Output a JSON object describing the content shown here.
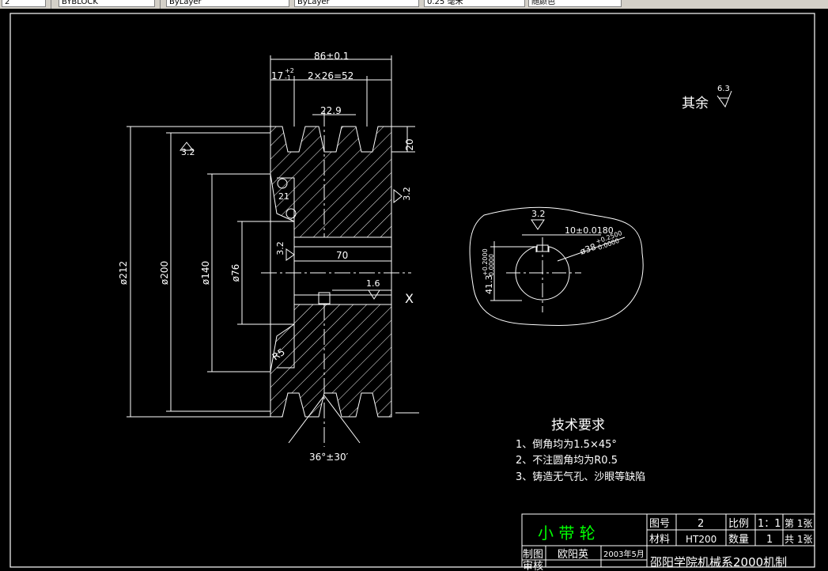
{
  "toolbar": {
    "fields": [
      {
        "value": "2"
      },
      {
        "value": "BYBLOCK"
      },
      {
        "value": "ByLayer"
      },
      {
        "value": "ByLayer"
      },
      {
        "value": "0.25 毫米"
      },
      {
        "value": "随颜色"
      }
    ]
  },
  "colors": {
    "background": "#000000",
    "lines": "#ffffff",
    "title_text": "#00ff00",
    "hatch": "#ffffff"
  },
  "drawing": {
    "dims": {
      "overall_width": "86±0.1",
      "first_groove": "17",
      "first_groove_tol_up": "+2",
      "first_groove_tol_dn": "-1",
      "groove_pitch": "2×26=52",
      "groove_top": "22.9",
      "groove_depth": "20",
      "rough_left": "3.2",
      "rough_right": "3.2",
      "rough_bore": "3.2",
      "chamfer": "21",
      "hub_length": "70",
      "rough_key": "1.6",
      "dia_212": "ø212",
      "dia_200": "ø200",
      "dia_140": "ø140",
      "dia_76": "ø76",
      "fillet": "R5",
      "groove_angle": "36°±30′",
      "section_mark": "X"
    },
    "section": {
      "rough": "3.2",
      "key_width": "10±0.0180",
      "bore_dia": "ø38",
      "bore_tol_up": "+0.2500",
      "bore_tol_dn": "0.0000",
      "key_depth": "41.3",
      "key_depth_tol_up": "+0.2000",
      "key_depth_tol_dn": "0.0000"
    },
    "rough_rest": {
      "label": "其余",
      "value": "6.3"
    },
    "tech": {
      "title": "技术要求",
      "items": [
        "1、倒角均为1.5×45°",
        "2、不注圆角均为R0.5",
        "3、铸造无气孔、沙眼等缺陷"
      ]
    }
  },
  "title_block": {
    "part_name": "小 带 轮",
    "drawing_no_label": "图号",
    "drawing_no": "2",
    "scale_label": "比例",
    "scale": "1：1",
    "sheet": "第 1张",
    "material_label": "材料",
    "material": "HT200",
    "qty_label": "数量",
    "qty": "1",
    "total_sheets": "共 1张",
    "drawn_label": "制图",
    "drawn_by": "欧阳英",
    "date": "2003年5月",
    "checked_label": "审核",
    "school": "邵阳学院机械系2000机制"
  }
}
